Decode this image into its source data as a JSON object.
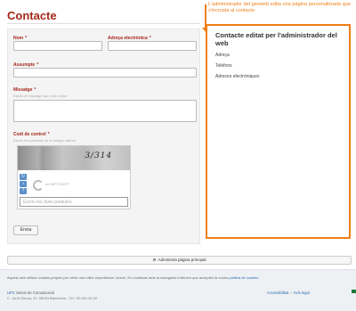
{
  "page": {
    "title": "Contacte"
  },
  "annotation": {
    "text": "L'administrador del genweb edita una pàgina personalitzada que s'incrusta al contacte"
  },
  "form": {
    "name_label": "Nom",
    "email_label": "Adreça electrònica",
    "subject_label": "Assumpte",
    "message_label": "Missatge",
    "message_hint": "Escriu el missatge que vols enviar",
    "captcha_label": "Codi de control",
    "captcha_hint": "Escriu les paraules de la imatge inferior",
    "captcha_code": "3/314",
    "recaptcha_brand": "reCAPTCHA™",
    "captcha_placeholder": "Escriu les dues paraules",
    "required_mark": "*",
    "send_label": "Envia"
  },
  "side": {
    "title": "Contacte editat per l'administrador del web",
    "lines": [
      "Adreça",
      "Telèfons",
      "Adreces electròniques"
    ]
  },
  "admin_bar": {
    "icon": "gear-icon",
    "label": "Administra pàgina principal"
  },
  "footer": {
    "cookie_text": "Aquest web utilitza cookies pròpies per oferir una millor experiència i servei. En continuar amb la navegació entenem que acceptes la nostra",
    "cookie_link": "política de cookies",
    "org_brand": "UPC",
    "org_name": "Servei de Comunicació",
    "address": "C. Jordi Girona, 31. 08034 Barcelona - Tel.: 93 401 62 00",
    "links": [
      "Accessibilitat",
      "Avís legal"
    ]
  },
  "colors": {
    "accent": "#a5281b",
    "highlight": "#f07f16",
    "link": "#2a6ab0"
  }
}
